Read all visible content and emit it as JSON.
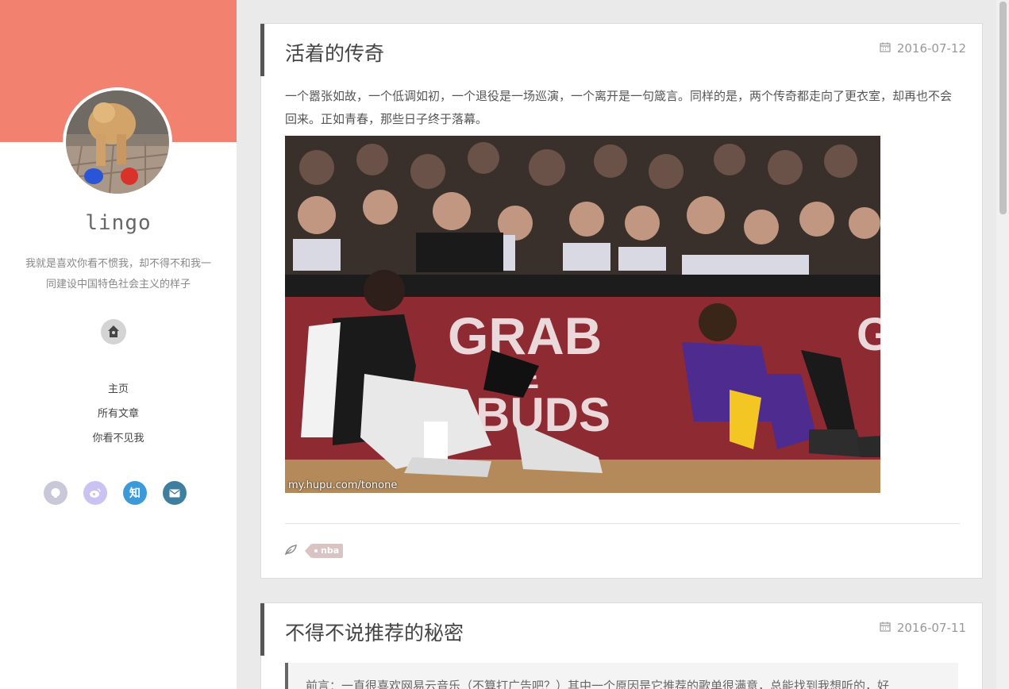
{
  "sidebar": {
    "site_name": "lingo",
    "bio": "我就是喜欢你看不惯我，却不得不和我一同建设中国特色社会主义的样子",
    "nav": [
      {
        "label": "主页"
      },
      {
        "label": "所有文章"
      },
      {
        "label": "你看不见我"
      }
    ],
    "social": [
      {
        "icon": "github-icon",
        "color": "#c8c8d8"
      },
      {
        "icon": "weibo-icon",
        "color": "#c9c2f2",
        "glyph": ""
      },
      {
        "icon": "zhihu-icon",
        "color": "#3d9ad8",
        "glyph": "知"
      },
      {
        "icon": "mail-icon",
        "color": "#3e7fa0"
      }
    ],
    "banner_color": "#f38170"
  },
  "posts": [
    {
      "title": "活着的传奇",
      "date": "2016-07-12",
      "excerpt": "一个嚣张如故，一个低调如初，一个退役是一场巡演，一个离开是一句箴言。同样的是，两个传奇都走向了更衣室，却再也不会回来。正如青春，那些日子终于落幕。",
      "image_watermark": "my.hupu.com/tonone",
      "tags": [
        "nba"
      ]
    },
    {
      "title": "不得不说推荐的秘密",
      "date": "2016-07-11",
      "quote": "前言：一直很喜欢网易云音乐（不算打广告吧？）其中一个原因是它推荐的歌单很满意，总能找到我想听的，好"
    }
  ]
}
